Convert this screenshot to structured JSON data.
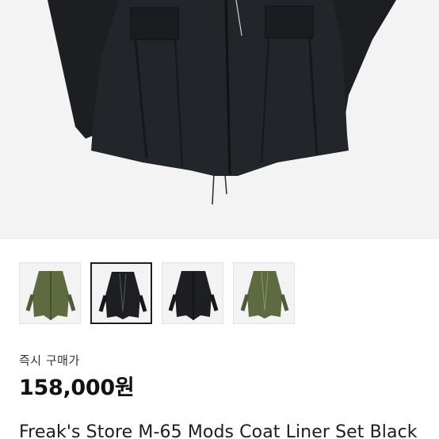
{
  "product": {
    "gallery": {
      "selected_index": 1,
      "thumbnails": [
        {
          "name": "olive-coat-front-view",
          "color": "#5e6a3f"
        },
        {
          "name": "black-coat-open-front",
          "color": "#1d1f23"
        },
        {
          "name": "black-coat-front-view",
          "color": "#1d1f23"
        },
        {
          "name": "olive-coat-open-front",
          "color": "#5e6a3f"
        }
      ]
    },
    "buy_label": "즉시 구매가",
    "price": "158,000원",
    "title": "Freak's Store M-65 Mods Coat Liner Set Black"
  }
}
